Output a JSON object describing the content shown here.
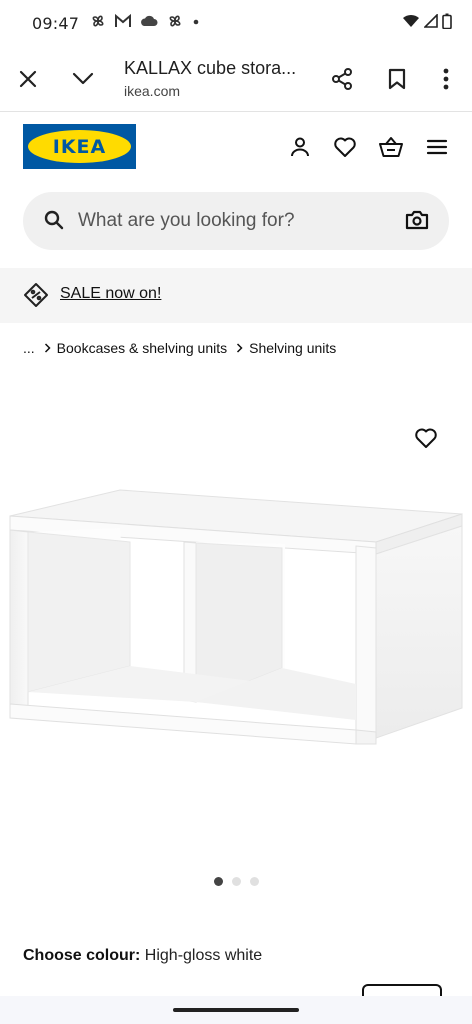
{
  "status_bar": {
    "time": "09:47",
    "icons": [
      "pinwheel-icon",
      "gmail-icon",
      "cloud-icon",
      "pinwheel-icon",
      "dot-icon"
    ],
    "right_icons": [
      "wifi-icon",
      "signal-icon",
      "battery-icon"
    ]
  },
  "custom_tab": {
    "title": "KALLAX cube stora...",
    "url": "ikea.com"
  },
  "header": {
    "logo_text": "IKEA",
    "colors": {
      "logo_blue": "#0058a3",
      "logo_yellow": "#ffdb00"
    }
  },
  "search": {
    "placeholder": "What are you looking for?"
  },
  "sale_banner": {
    "link_text": "SALE now on!"
  },
  "breadcrumb": {
    "ellipsis": "...",
    "items": [
      "Bookcases & shelving units",
      "Shelving units"
    ]
  },
  "gallery": {
    "dot_count": 3,
    "active_index": 0
  },
  "colour": {
    "label": "Choose colour:",
    "value": "High-gloss white"
  }
}
